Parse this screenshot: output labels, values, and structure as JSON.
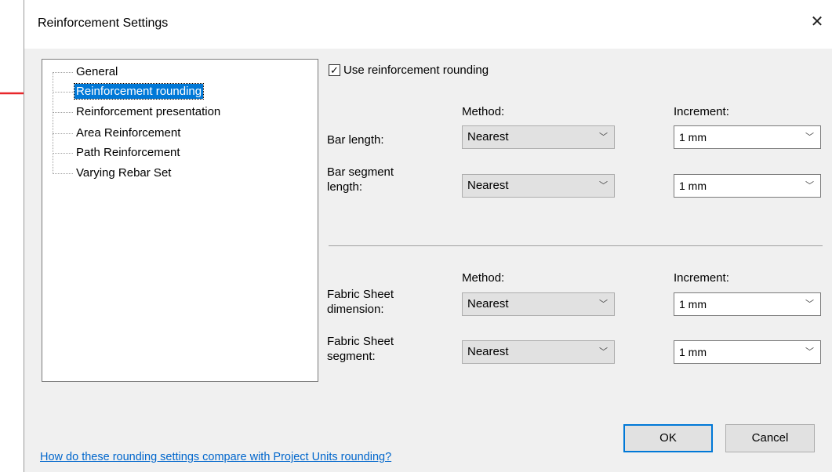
{
  "window": {
    "title": "Reinforcement Settings",
    "close_glyph": "✕"
  },
  "tree": {
    "items": [
      {
        "label": "General",
        "selected": false
      },
      {
        "label": "Reinforcement rounding",
        "selected": true
      },
      {
        "label": "Reinforcement presentation",
        "selected": false
      },
      {
        "label": "Area Reinforcement",
        "selected": false
      },
      {
        "label": "Path Reinforcement",
        "selected": false
      },
      {
        "label": "Varying Rebar Set",
        "selected": false
      }
    ]
  },
  "rounding": {
    "use_checkbox": {
      "label": "Use reinforcement rounding",
      "checked": true,
      "check_glyph": "✓"
    },
    "bar_group": {
      "method_header": "Method:",
      "increment_header": "Increment:",
      "rows": [
        {
          "label_line1": "Bar length:",
          "label_line2": "",
          "method": "Nearest",
          "increment": "1 mm"
        },
        {
          "label_line1": "Bar segment",
          "label_line2": "length:",
          "method": "Nearest",
          "increment": "1 mm"
        }
      ]
    },
    "fabric_group": {
      "method_header": "Method:",
      "increment_header": "Increment:",
      "rows": [
        {
          "label_line1": "Fabric Sheet",
          "label_line2": "dimension:",
          "method": "Nearest",
          "increment": "1 mm"
        },
        {
          "label_line1": "Fabric Sheet",
          "label_line2": "segment:",
          "method": "Nearest",
          "increment": "1 mm"
        }
      ]
    }
  },
  "footer": {
    "help_link": "How do these rounding settings compare with Project Units rounding?",
    "ok_label": "OK",
    "cancel_label": "Cancel"
  },
  "icons": {
    "dropdown": "chevron-down-icon",
    "arrow_color": "#e8262a",
    "selection_color": "#0078d7",
    "link_color": "#0066cc"
  }
}
